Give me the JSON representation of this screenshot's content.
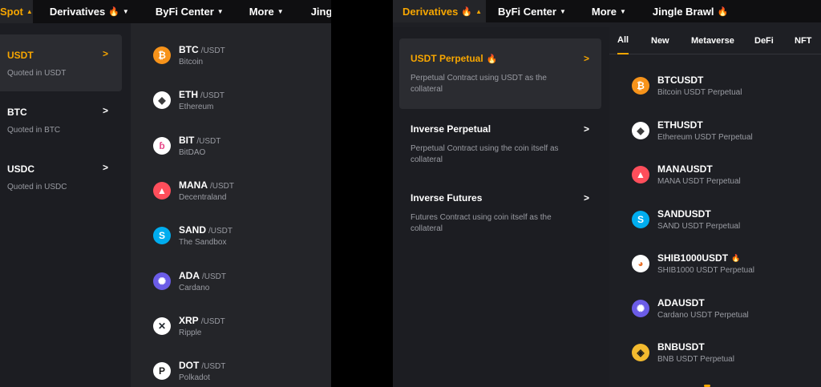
{
  "left_nav": [
    {
      "label": "Spot",
      "active": true,
      "caret": "▲",
      "flame": false
    },
    {
      "label": "Derivatives",
      "active": false,
      "caret": "▼",
      "flame": true
    },
    {
      "label": "ByFi Center",
      "active": false,
      "caret": "▼",
      "flame": false
    },
    {
      "label": "More",
      "active": false,
      "caret": "▼",
      "flame": false
    },
    {
      "label": "Jingle Bra",
      "active": false,
      "caret": "",
      "flame": false
    }
  ],
  "spot_categories": [
    {
      "title": "USDT",
      "sub": "Quoted in USDT",
      "selected": true
    },
    {
      "title": "BTC",
      "sub": "Quoted in BTC",
      "selected": false
    },
    {
      "title": "USDC",
      "sub": "Quoted in USDC",
      "selected": false
    }
  ],
  "spot_pairs": [
    {
      "base": "BTC",
      "quote": "/USDT",
      "name": "Bitcoin",
      "icon": "bitcoin-icon",
      "glyph": "₿",
      "bg": "#f7931a",
      "fg": "#ffffff"
    },
    {
      "base": "ETH",
      "quote": "/USDT",
      "name": "Ethereum",
      "icon": "ethereum-icon",
      "glyph": "◆",
      "bg": "#ffffff",
      "fg": "#3c3c3d"
    },
    {
      "base": "BIT",
      "quote": "/USDT",
      "name": "BitDAO",
      "icon": "bitdao-icon",
      "glyph": "ɓ",
      "bg": "#ffffff",
      "fg": "#e84a8a"
    },
    {
      "base": "MANA",
      "quote": "/USDT",
      "name": "Decentraland",
      "icon": "decentraland-icon",
      "glyph": "▲",
      "bg": "#ff4e5b",
      "fg": "#ffffff"
    },
    {
      "base": "SAND",
      "quote": "/USDT",
      "name": "The Sandbox",
      "icon": "sandbox-icon",
      "glyph": "S",
      "bg": "#00adef",
      "fg": "#ffffff"
    },
    {
      "base": "ADA",
      "quote": "/USDT",
      "name": "Cardano",
      "icon": "cardano-icon",
      "glyph": "✺",
      "bg": "#6b5ce7",
      "fg": "#ffffff"
    },
    {
      "base": "XRP",
      "quote": "/USDT",
      "name": "Ripple",
      "icon": "ripple-icon",
      "glyph": "✕",
      "bg": "#ffffff",
      "fg": "#23292f"
    },
    {
      "base": "DOT",
      "quote": "/USDT",
      "name": "Polkadot",
      "icon": "polkadot-icon",
      "glyph": "P",
      "bg": "#ffffff",
      "fg": "#1a1a1a"
    }
  ],
  "right_nav": [
    {
      "label": "Derivatives",
      "active": true,
      "caret": "▲",
      "flame": true
    },
    {
      "label": "ByFi Center",
      "active": false,
      "caret": "▼",
      "flame": false
    },
    {
      "label": "More",
      "active": false,
      "caret": "▼",
      "flame": false
    },
    {
      "label": "Jingle Brawl",
      "active": false,
      "caret": "",
      "flame": true
    }
  ],
  "deriv_categories": [
    {
      "title": "USDT Perpetual",
      "desc": "Perpetual Contract using USDT as the collateral",
      "selected": true,
      "flame": true
    },
    {
      "title": "Inverse Perpetual",
      "desc": "Perpetual Contract using the coin itself as collateral",
      "selected": false,
      "flame": false
    },
    {
      "title": "Inverse Futures",
      "desc": "Futures Contract using coin itself as the collateral",
      "selected": false,
      "flame": false
    }
  ],
  "deriv_tabs": [
    {
      "label": "All",
      "active": true
    },
    {
      "label": "New",
      "active": false
    },
    {
      "label": "Metaverse",
      "active": false
    },
    {
      "label": "DeFi",
      "active": false
    },
    {
      "label": "NFT",
      "active": false
    }
  ],
  "contracts": [
    {
      "symbol": "BTCUSDT",
      "name": "Bitcoin USDT Perpetual",
      "icon": "bitcoin-icon",
      "glyph": "₿",
      "bg": "#f7931a",
      "fg": "#ffffff",
      "flame": false
    },
    {
      "symbol": "ETHUSDT",
      "name": "Ethereum USDT Perpetual",
      "icon": "ethereum-icon",
      "glyph": "◆",
      "bg": "#ffffff",
      "fg": "#3c3c3d",
      "flame": false
    },
    {
      "symbol": "MANAUSDT",
      "name": "MANA USDT Perpetual",
      "icon": "decentraland-icon",
      "glyph": "▲",
      "bg": "#ff4e5b",
      "fg": "#ffffff",
      "flame": false
    },
    {
      "symbol": "SANDUSDT",
      "name": "SAND USDT Perpetual",
      "icon": "sandbox-icon",
      "glyph": "S",
      "bg": "#00adef",
      "fg": "#ffffff",
      "flame": false
    },
    {
      "symbol": "SHIB1000USDT",
      "name": "SHIB1000 USDT Perpetual",
      "icon": "shiba-icon",
      "glyph": "◕",
      "bg": "#ffffff",
      "fg": "#e8702a",
      "flame": true
    },
    {
      "symbol": "ADAUSDT",
      "name": "Cardano USDT Perpetual",
      "icon": "cardano-icon",
      "glyph": "✺",
      "bg": "#6b5ce7",
      "fg": "#ffffff",
      "flame": false
    },
    {
      "symbol": "BNBUSDT",
      "name": "BNB USDT Perpetual",
      "icon": "bnb-icon",
      "glyph": "◈",
      "bg": "#f3ba2f",
      "fg": "#1a1a1a",
      "flame": false
    }
  ],
  "colors": {
    "accent": "#f7a600",
    "panel": "#242529",
    "muted": "#9a9ca3"
  }
}
